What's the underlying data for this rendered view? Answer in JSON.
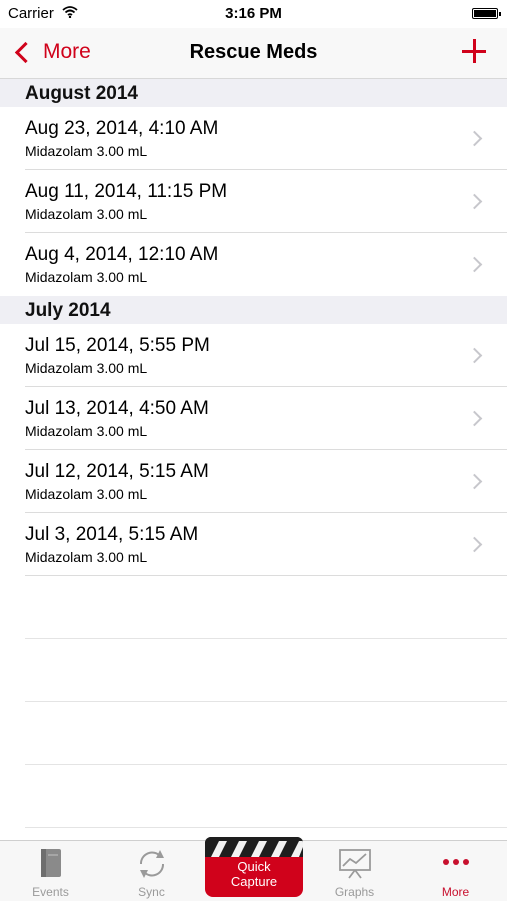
{
  "status": {
    "carrier": "Carrier",
    "time": "3:16 PM"
  },
  "nav": {
    "back_label": "More",
    "title": "Rescue Meds"
  },
  "sections": [
    {
      "header": "August 2014",
      "rows": [
        {
          "title": "Aug 23, 2014, 4:10 AM",
          "subtitle": "Midazolam 3.00 mL"
        },
        {
          "title": "Aug 11, 2014, 11:15 PM",
          "subtitle": "Midazolam 3.00 mL"
        },
        {
          "title": "Aug 4, 2014, 12:10 AM",
          "subtitle": "Midazolam 3.00 mL"
        }
      ]
    },
    {
      "header": "July 2014",
      "rows": [
        {
          "title": "Jul 15, 2014, 5:55 PM",
          "subtitle": "Midazolam 3.00 mL"
        },
        {
          "title": "Jul 13, 2014, 4:50 AM",
          "subtitle": "Midazolam 3.00 mL"
        },
        {
          "title": "Jul 12, 2014, 5:15 AM",
          "subtitle": "Midazolam 3.00 mL"
        },
        {
          "title": "Jul 3, 2014, 5:15 AM",
          "subtitle": "Midazolam 3.00 mL"
        }
      ]
    }
  ],
  "tabbar": {
    "events": "Events",
    "sync": "Sync",
    "quick_line1": "Quick",
    "quick_line2": "Capture",
    "graphs": "Graphs",
    "more": "More"
  },
  "colors": {
    "accent": "#d0021b"
  }
}
